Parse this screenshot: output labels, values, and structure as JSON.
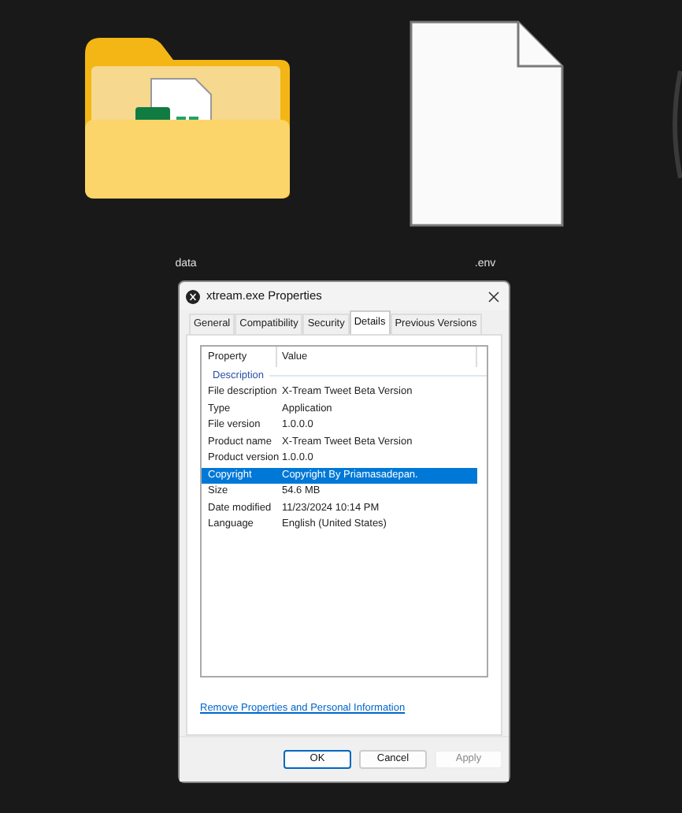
{
  "desktop_items": [
    {
      "kind": "folder",
      "label": "data"
    },
    {
      "kind": "file",
      "label": ".env"
    }
  ],
  "dialog": {
    "title": "xtream.exe Properties",
    "tabs": [
      {
        "label": "General",
        "selected": false
      },
      {
        "label": "Compatibility",
        "selected": false
      },
      {
        "label": "Security",
        "selected": false
      },
      {
        "label": "Details",
        "selected": true
      },
      {
        "label": "Previous Versions",
        "selected": false
      }
    ],
    "columns": [
      "Property",
      "Value"
    ],
    "group": "Description",
    "rows": [
      {
        "property": "File description",
        "value": "X-Tream Tweet Beta Version",
        "selected": false
      },
      {
        "property": "Type",
        "value": "Application",
        "selected": false
      },
      {
        "property": "File version",
        "value": "1.0.0.0",
        "selected": false
      },
      {
        "property": "Product name",
        "value": "X-Tream Tweet Beta Version",
        "selected": false
      },
      {
        "property": "Product version",
        "value": "1.0.0.0",
        "selected": false
      },
      {
        "property": "Copyright",
        "value": "Copyright By Priamasadepan.",
        "selected": true
      },
      {
        "property": "Size",
        "value": "54.6 MB",
        "selected": false
      },
      {
        "property": "Date modified",
        "value": "11/23/2024 10:14 PM",
        "selected": false
      },
      {
        "property": "Language",
        "value": "English (United States)",
        "selected": false
      }
    ],
    "link": "Remove Properties and Personal Information",
    "buttons": [
      {
        "label": "OK",
        "kind": "default",
        "disabled": false
      },
      {
        "label": "Cancel",
        "kind": "normal",
        "disabled": false
      },
      {
        "label": "Apply",
        "kind": "normal",
        "disabled": true
      }
    ]
  }
}
